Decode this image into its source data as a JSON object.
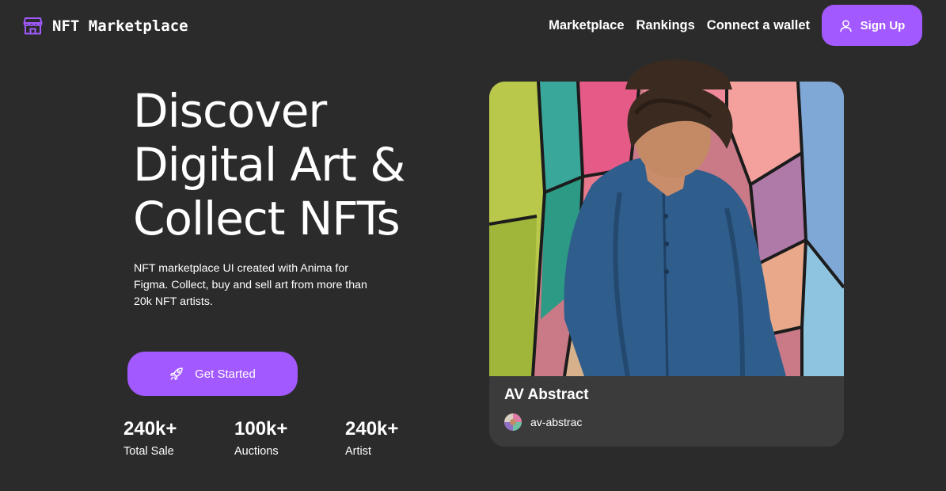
{
  "brand": {
    "name": "NFT Marketplace",
    "icon": "storefront-icon",
    "accent_color": "#a259ff"
  },
  "nav": {
    "links": [
      {
        "label": "Marketplace"
      },
      {
        "label": "Rankings"
      },
      {
        "label": "Connect a wallet"
      }
    ],
    "signup": {
      "label": "Sign Up",
      "icon": "user-icon"
    }
  },
  "hero": {
    "title_lines": [
      "Discover",
      "Digital Art &",
      "Collect NFTs"
    ],
    "description": "NFT marketplace UI created with Anima for Figma. Collect, buy and sell art from more than 20k NFT artists.",
    "cta": {
      "label": "Get Started",
      "icon": "rocket-icon"
    },
    "stats": [
      {
        "value": "240k+",
        "label": "Total Sale"
      },
      {
        "value": "100k+",
        "label": "Auctions"
      },
      {
        "value": "240k+",
        "label": "Artist"
      }
    ]
  },
  "featured": {
    "title": "AV Abstract",
    "artist": "av-abstrac",
    "card_color": "#3b3b3b",
    "background_color": "#2b2b2b"
  }
}
